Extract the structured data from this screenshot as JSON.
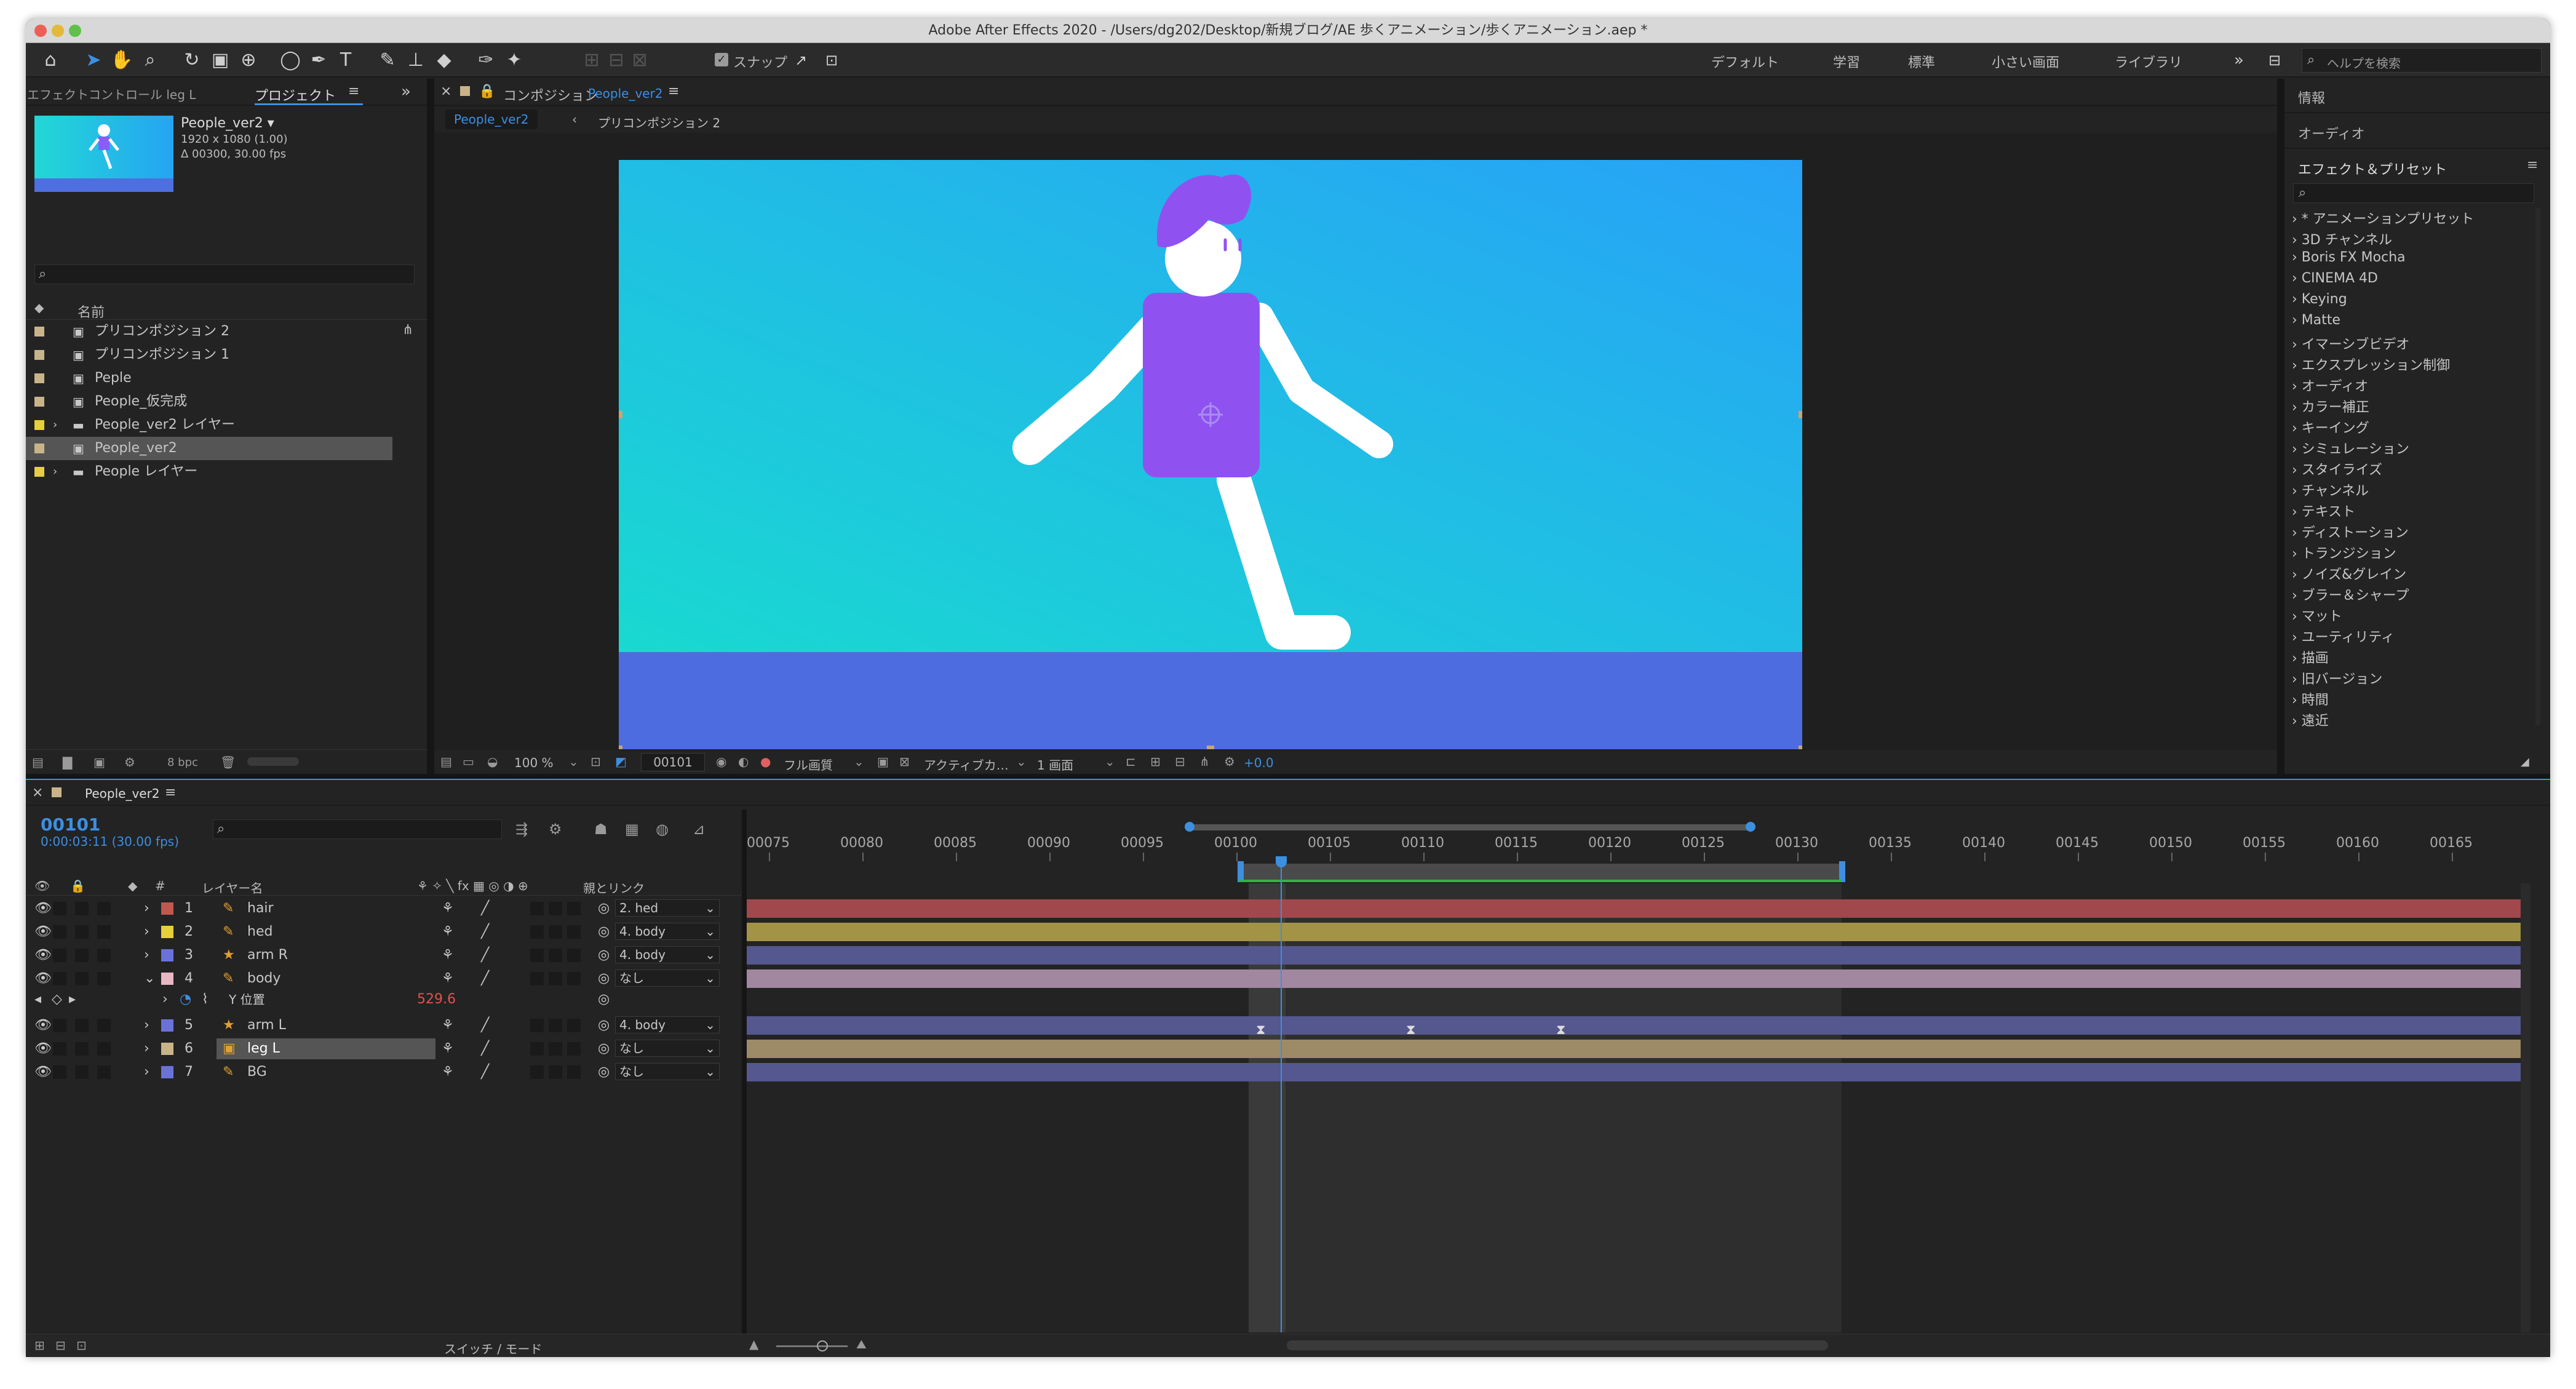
{
  "window": {
    "title": "Adobe After Effects 2020 - /Users/dg202/Desktop/新規ブログ/AE 歩くアニメーション/歩くアニメーション.aep *"
  },
  "toolbar": {
    "snap_label": "スナップ",
    "workspaces": [
      "デフォルト",
      "学習",
      "標準",
      "小さい画面",
      "ライブラリ"
    ],
    "search_placeholder": "ヘルプを検索"
  },
  "left_panel": {
    "tab_effects": "エフェクトコントロール leg L",
    "tab_project": "プロジェクト",
    "selected_name": "People_ver2 ▾",
    "selected_info": [
      "1920 x 1080 (1.00)",
      "Δ 00300, 30.00 fps"
    ],
    "column_name": "名前",
    "items": [
      {
        "label": "プリコンポジション 2",
        "type": "comp",
        "color": "#c9b48a"
      },
      {
        "label": "プリコンポジション 1",
        "type": "comp",
        "color": "#c9b48a"
      },
      {
        "label": "Peple",
        "type": "comp",
        "color": "#c9b48a"
      },
      {
        "label": "People_仮完成",
        "type": "comp",
        "color": "#c9b48a"
      },
      {
        "label": "People_ver2 レイヤー",
        "type": "folder",
        "color": "#e6cf3a"
      },
      {
        "label": "People_ver2",
        "type": "comp",
        "color": "#c9b48a"
      },
      {
        "label": "People レイヤー",
        "type": "folder",
        "color": "#e6cf3a"
      }
    ],
    "bpc": "8 bpc"
  },
  "composition": {
    "header_label": "コンポジション",
    "header_name": "People_ver2",
    "breadcrumb_active": "People_ver2",
    "breadcrumb_next": "プリコンポジション 2",
    "zoom": "100 %",
    "timecode": "00101",
    "resolution": "フル画質",
    "camera": "アクティブカ…",
    "views": "1 画面",
    "exposure": "+0.0"
  },
  "right_panel": {
    "info": "情報",
    "audio": "オーディオ",
    "effects_title": "エフェクト＆プリセット",
    "items": [
      "* アニメーションプリセット",
      "3D チャンネル",
      "Boris FX Mocha",
      "CINEMA 4D",
      "Keying",
      "Matte",
      "イマーシブビデオ",
      "エクスプレッション制御",
      "オーディオ",
      "カラー補正",
      "キーイング",
      "シミュレーション",
      "スタイライズ",
      "チャンネル",
      "テキスト",
      "ディストーション",
      "トランジション",
      "ノイズ&グレイン",
      "ブラー＆シャープ",
      "マット",
      "ユーティリティ",
      "描画",
      "旧バージョン",
      "時間",
      "遠近"
    ]
  },
  "timeline": {
    "tab": "People_ver2",
    "current_frame": "00101",
    "current_time": "0:00:03:11 (30.00 fps)",
    "col_layer_name": "レイヤー名",
    "col_parent": "親とリンク",
    "ruler": [
      "00075",
      "00080",
      "00085",
      "00090",
      "00095",
      "00100",
      "00105",
      "00110",
      "00115",
      "00120",
      "00125",
      "00130",
      "00135",
      "00140",
      "00145",
      "00150",
      "00155",
      "00160",
      "00165"
    ],
    "layers": [
      {
        "num": "1",
        "name": "hair",
        "label_color": "#c0584f",
        "type": "shape",
        "parent": "2. hed",
        "bar_color": "#a0484c"
      },
      {
        "num": "2",
        "name": "hed",
        "label_color": "#e6cf3a",
        "type": "shape",
        "parent": "4. body",
        "bar_color": "#a39347"
      },
      {
        "num": "3",
        "name": "arm R",
        "label_color": "#6a72d8",
        "type": "star",
        "parent": "4. body",
        "bar_color": "#55578f"
      },
      {
        "num": "4",
        "name": "body",
        "label_color": "#e7b7c2",
        "type": "shape",
        "parent": "なし",
        "bar_color": "#a287a0"
      },
      {
        "num": "5",
        "name": "arm L",
        "label_color": "#6a72d8",
        "type": "star",
        "parent": "4. body",
        "bar_color": "#55578f"
      },
      {
        "num": "6",
        "name": "leg L",
        "label_color": "#c9b48a",
        "type": "precomp",
        "parent": "なし",
        "bar_color": "#9d8a66"
      },
      {
        "num": "7",
        "name": "BG",
        "label_color": "#6a72d8",
        "type": "shape",
        "parent": "なし",
        "bar_color": "#55578f"
      }
    ],
    "property_name": "Y 位置",
    "property_value": "529.6",
    "footer_label": "スイッチ / モード"
  }
}
